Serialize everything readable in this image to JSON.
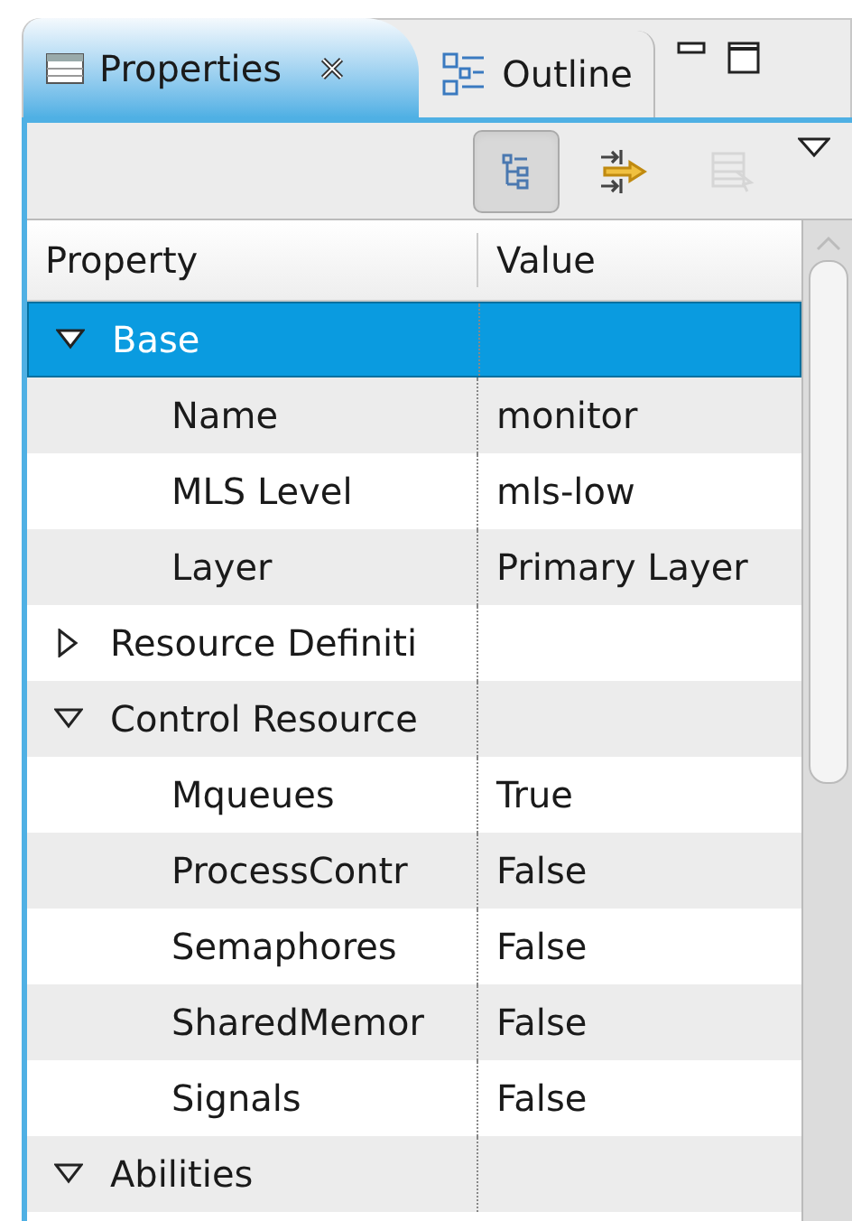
{
  "tabs": [
    {
      "label": "Properties",
      "selected": true,
      "closable": true
    },
    {
      "label": "Outline",
      "selected": false,
      "closable": false
    }
  ],
  "toolbar": [
    {
      "kind": "tree",
      "pressed": true,
      "disabled": false
    },
    {
      "kind": "filter",
      "pressed": false,
      "disabled": false
    },
    {
      "kind": "restore",
      "pressed": false,
      "disabled": true
    }
  ],
  "table": {
    "columns": [
      "Property",
      "Value"
    ],
    "rows": [
      {
        "property": "Base",
        "value": "",
        "selected": true,
        "expanded": true,
        "children": [
          {
            "property": "Name",
            "value": "monitor",
            "selected": false
          },
          {
            "property": "MLS Level",
            "value": "mls-low",
            "selected": false
          },
          {
            "property": "Layer",
            "value": "Primary Layer",
            "selected": false
          }
        ]
      },
      {
        "property": "Resource Definiti",
        "value": "",
        "selected": false,
        "expanded": false
      },
      {
        "property": "Control Resource",
        "value": "",
        "selected": false,
        "expanded": true,
        "children": [
          {
            "property": "Mqueues",
            "value": "True",
            "selected": false
          },
          {
            "property": "ProcessContr",
            "value": "False",
            "selected": false
          },
          {
            "property": "Semaphores",
            "value": "False",
            "selected": false
          },
          {
            "property": "SharedMemor",
            "value": "False",
            "selected": false
          },
          {
            "property": "Signals",
            "value": "False",
            "selected": false
          }
        ]
      },
      {
        "property": "Abilities",
        "value": "",
        "selected": false,
        "expanded": true
      }
    ]
  }
}
